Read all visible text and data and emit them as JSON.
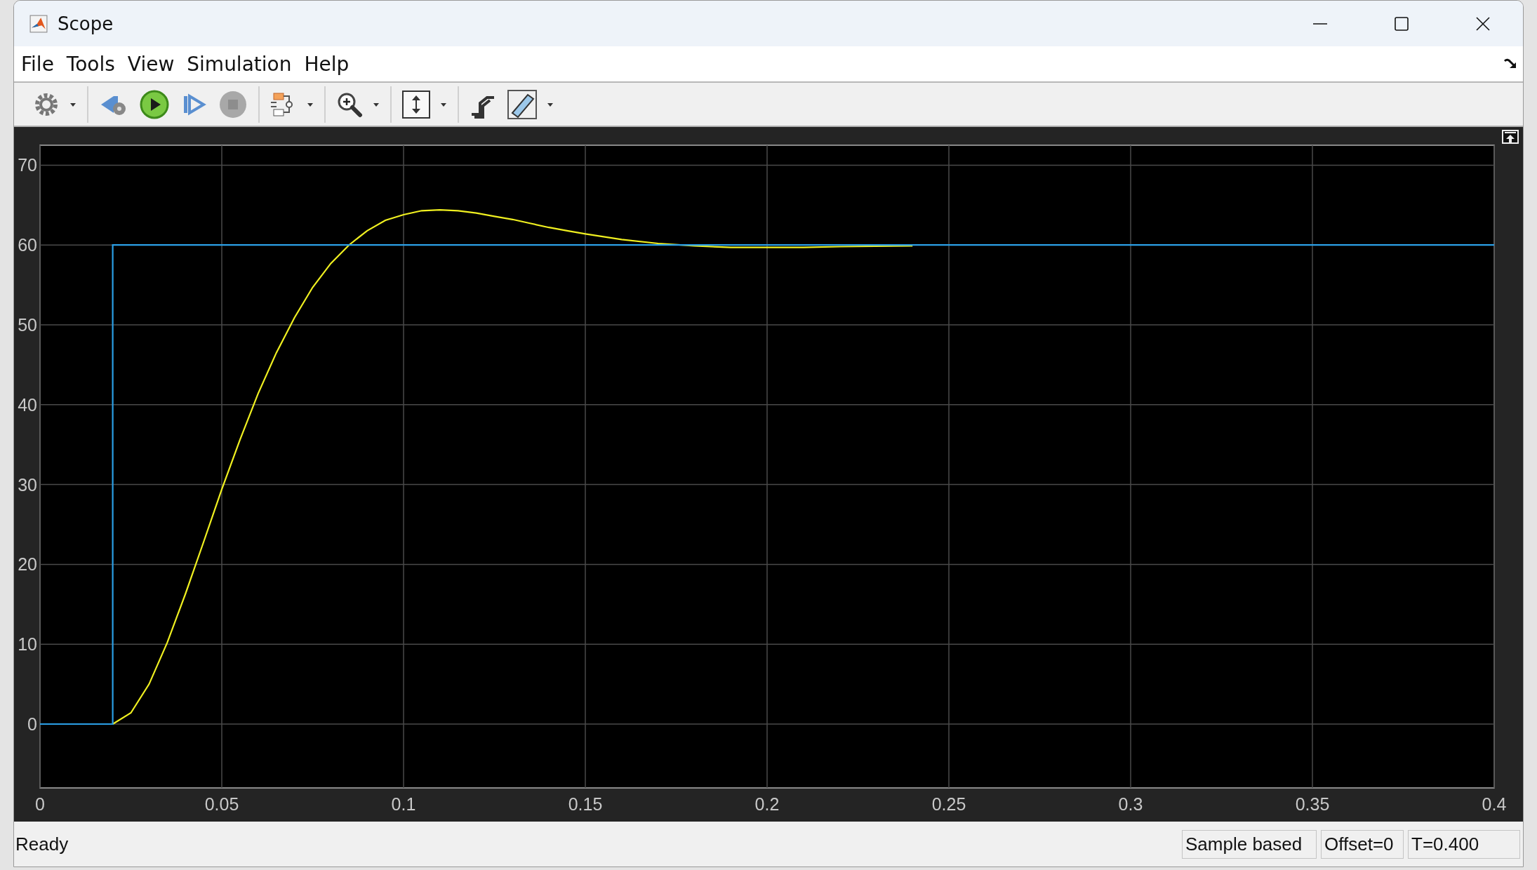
{
  "window": {
    "title": "Scope"
  },
  "menu": [
    "File",
    "Tools",
    "View",
    "Simulation",
    "Help"
  ],
  "chart_data": {
    "type": "line",
    "xlim": [
      0,
      0.4
    ],
    "ylim": [
      -8,
      72.5
    ],
    "xticks": [
      0,
      0.05,
      0.1,
      0.15,
      0.2,
      0.25,
      0.3,
      0.35,
      0.4
    ],
    "yticks": [
      0,
      10,
      20,
      30,
      40,
      50,
      60,
      70
    ],
    "grid": true,
    "x": [
      0,
      0.02,
      0.02,
      0.025,
      0.03,
      0.035,
      0.04,
      0.045,
      0.05,
      0.055,
      0.06,
      0.065,
      0.07,
      0.075,
      0.08,
      0.085,
      0.09,
      0.095,
      0.1,
      0.105,
      0.11,
      0.115,
      0.12,
      0.125,
      0.13,
      0.135,
      0.14,
      0.145,
      0.15,
      0.16,
      0.17,
      0.18,
      0.19,
      0.2,
      0.21,
      0.22,
      0.24,
      0.26,
      0.28,
      0.3,
      0.35,
      0.4
    ],
    "series": [
      {
        "color": "#f0f020",
        "values": [
          null,
          null,
          0,
          1.4,
          5,
          10.2,
          16.3,
          22.8,
          29.4,
          35.6,
          41.4,
          46.5,
          50.9,
          54.7,
          57.7,
          60,
          61.8,
          63.1,
          63.8,
          64.3,
          64.4,
          64.3,
          64,
          63.6,
          63.2,
          62.7,
          62.2,
          61.8,
          61.4,
          60.7,
          60.2,
          59.9,
          59.7,
          59.7,
          59.7,
          59.8,
          59.9,
          null,
          null,
          null,
          null,
          null
        ]
      },
      {
        "color": "#2b9fe6",
        "values": [
          0,
          0,
          60,
          60,
          60,
          60,
          60,
          60,
          60,
          60,
          60,
          60,
          60,
          60,
          60,
          60,
          60,
          60,
          60,
          60,
          60,
          60,
          60,
          60,
          60,
          60,
          60,
          60,
          60,
          60,
          60,
          60,
          60,
          60,
          60,
          60,
          60,
          60,
          60,
          60,
          60,
          60
        ]
      }
    ]
  },
  "status_bar": {
    "message": "Ready",
    "fields": [
      "Sample based",
      "Offset=0",
      "T=0.400"
    ]
  }
}
